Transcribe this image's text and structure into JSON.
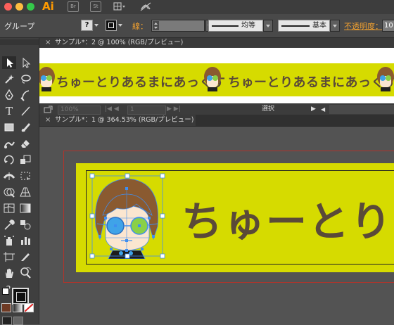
{
  "app": {
    "icon_label": "Ai",
    "br_label": "Br",
    "st_label": "St"
  },
  "control_bar": {
    "selection_label": "グループ",
    "question_mark": "?",
    "stroke_label": "線：",
    "stroke_value": "",
    "profile_label": "均等",
    "brush_label": "基本",
    "opacity_label": "不透明度：",
    "opacity_value": "10"
  },
  "tabs": {
    "doc2_title": "サンプル*：2 @ 100% (RGB/プレビュー)",
    "doc1_title": "サンプル*：1 @ 364.53% (RGB/プレビュー)"
  },
  "doc2_status": {
    "zoom": "100%",
    "page": "1",
    "selection_label": "選択"
  },
  "banner": {
    "text_small": "ちゅーとりあるまにあっくす",
    "text_large": "ちゅーとりあ"
  },
  "tools": {
    "help_glyph": "?"
  },
  "colors": {
    "banner_yellow": "#d6db00",
    "banner_text": "#5a4a38",
    "selection_blue": "#3f8ef0",
    "artboard_red": "#b0342c",
    "ai_orange": "#ff9a00"
  }
}
